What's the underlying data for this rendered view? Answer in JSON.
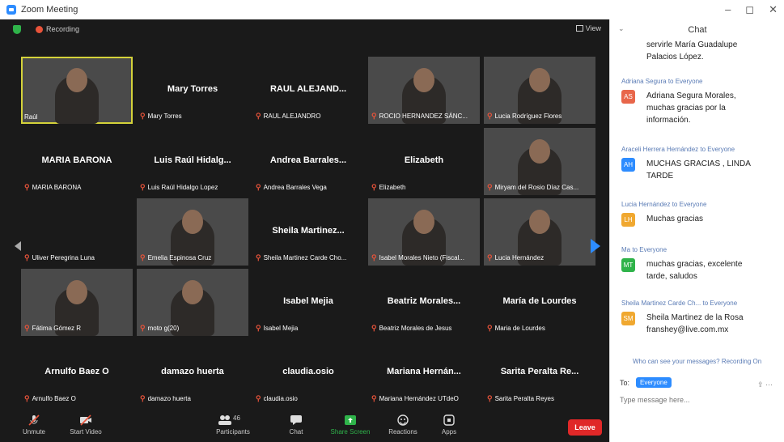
{
  "window": {
    "title": "Zoom Meeting",
    "controls": [
      "–",
      "◻",
      "✕"
    ]
  },
  "topbar": {
    "recording": "Recording",
    "view": "View"
  },
  "tiles": [
    {
      "name": "Raúl",
      "big": "",
      "video": true,
      "active": true
    },
    {
      "name": "Mary Torres",
      "big": "Mary Torres",
      "video": false
    },
    {
      "name": "RAUL ALEJANDRO",
      "big": "RAUL ALEJAND...",
      "video": false
    },
    {
      "name": "ROCIO HERNANDEZ SÁNC...",
      "big": "",
      "video": true
    },
    {
      "name": "Lucia Rodríguez Flores",
      "big": "",
      "video": true
    },
    {
      "name": "MARIA BARONA",
      "big": "MARIA BARONA",
      "video": false
    },
    {
      "name": "Luis Raúl Hidalgo Lopez",
      "big": "Luis Raúl Hidalg...",
      "video": false
    },
    {
      "name": "Andrea Barrales Vega",
      "big": "Andrea Barrales...",
      "video": false
    },
    {
      "name": "Elizabeth",
      "big": "Elizabeth",
      "video": false
    },
    {
      "name": "Miryam del Rosio Díaz Cas...",
      "big": "",
      "video": true
    },
    {
      "name": "Uliver Peregrina Luna",
      "big": "",
      "video": false
    },
    {
      "name": "Emelia Espinosa Cruz",
      "big": "",
      "video": true
    },
    {
      "name": "Sheila Martinez Carde Cho...",
      "big": "Sheila Martinez...",
      "video": false
    },
    {
      "name": "Isabel Morales Nieto (Fiscal...",
      "big": "",
      "video": true
    },
    {
      "name": "Lucia Hernández",
      "big": "",
      "video": true
    },
    {
      "name": "Fátima Gómez R",
      "big": "",
      "video": true
    },
    {
      "name": "moto g(20)",
      "big": "",
      "video": true
    },
    {
      "name": "Isabel Mejia",
      "big": "Isabel Mejia",
      "video": false
    },
    {
      "name": "Beatriz Morales de Jesus",
      "big": "Beatriz Morales...",
      "video": false
    },
    {
      "name": "Maria de Lourdes",
      "big": "María de Lourdes",
      "video": false
    },
    {
      "name": "Arnulfo Baez O",
      "big": "Arnulfo Baez O",
      "video": false
    },
    {
      "name": "damazo huerta",
      "big": "damazo huerta",
      "video": false
    },
    {
      "name": "claudia.osio",
      "big": "claudia.osio",
      "video": false
    },
    {
      "name": "Mariana Hernández UTdeO",
      "big": "Mariana Hernán...",
      "video": false
    },
    {
      "name": "Sarita Peralta Reyes",
      "big": "Sarita Peralta Re...",
      "video": false
    }
  ],
  "toolbar": {
    "unmute": "Unmute",
    "start_video": "Start Video",
    "participants": "Participants",
    "participant_count": "46",
    "chat": "Chat",
    "share_screen": "Share Screen",
    "reactions": "Reactions",
    "apps": "Apps",
    "leave": "Leave"
  },
  "chat": {
    "title": "Chat",
    "messages": [
      {
        "from": "",
        "initials": "",
        "color": "",
        "text": "servirle María Guadalupe\nPalacios López."
      },
      {
        "from": "Adriana Segura to Everyone",
        "initials": "AS",
        "color": "#e8664a",
        "text": "Adriana Segura Morales,\nmuchas gracias por la\ninformación."
      },
      {
        "from": "Araceli Herrera Hernández to Everyone",
        "initials": "AH",
        "color": "#2d8cff",
        "text": "MUCHAS GRACIAS , LINDA\nTARDE"
      },
      {
        "from": "Lucia Hernández to Everyone",
        "initials": "LH",
        "color": "#f0a830",
        "text": "Muchas gracias"
      },
      {
        "from": "Ma to Everyone",
        "initials": "MT",
        "color": "#2fb34a",
        "text": "muchas gracias, excelente\ntarde, saludos"
      },
      {
        "from": "Sheila Martinez Carde Ch... to Everyone",
        "initials": "SM",
        "color": "#f0a830",
        "text": "Sheila Martinez de la Rosa\nfranshey@live.com.mx"
      }
    ],
    "notice": "Who can see your messages? Recording On",
    "to_label": "To:",
    "to_value": "Everyone",
    "input_placeholder": "Type message here..."
  }
}
